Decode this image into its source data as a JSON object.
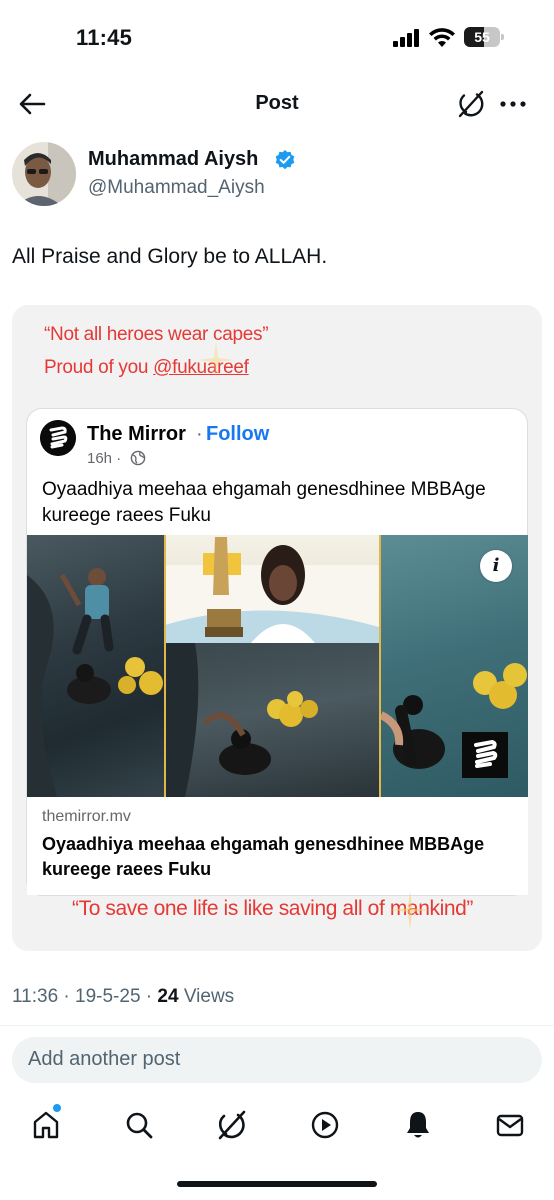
{
  "status_bar": {
    "time": "11:45",
    "battery": "55",
    "battery_level": 0.55
  },
  "header": {
    "title": "Post"
  },
  "author": {
    "name": "Muhammad Aiysh",
    "handle": "@Muhammad_Aiysh",
    "verified": true
  },
  "post": {
    "text": "All Praise and Glory be to ALLAH.",
    "image": {
      "quote_line1": "“Not all heroes wear capes”",
      "quote_line2_prefix": "Proud of you ",
      "quote_line2_mention": "@fukuareef",
      "embedded_post": {
        "page_name": "The Mirror",
        "separator": " ·",
        "follow_label": "Follow",
        "time": "16h ·",
        "caption": "Oyaadhiya meehaa ehgamah genesdhinee MBBAge kureege raees Fuku",
        "info_label": "i",
        "link_domain": "themirror.mv",
        "link_title": "Oyaadhiya meehaa ehgamah genesdhinee MBBAge kureege raees Fuku"
      },
      "quote_bottom": "“To save one life is like saving all of mankind”"
    },
    "meta": {
      "time": "11:36",
      "date": "19-5-25",
      "views_count": "24",
      "views_label": "Views"
    }
  },
  "reply": {
    "placeholder": "Add another post"
  },
  "nav": {
    "items": [
      {
        "icon": "home-icon"
      },
      {
        "icon": "search-icon"
      },
      {
        "icon": "grok-icon"
      },
      {
        "icon": "video-icon"
      },
      {
        "icon": "notifications-icon"
      },
      {
        "icon": "messages-icon"
      }
    ]
  },
  "colors": {
    "accent": "#1d9bf0",
    "quote_red": "#e53935",
    "follow_blue": "#1877f2",
    "text_secondary": "#536471"
  }
}
